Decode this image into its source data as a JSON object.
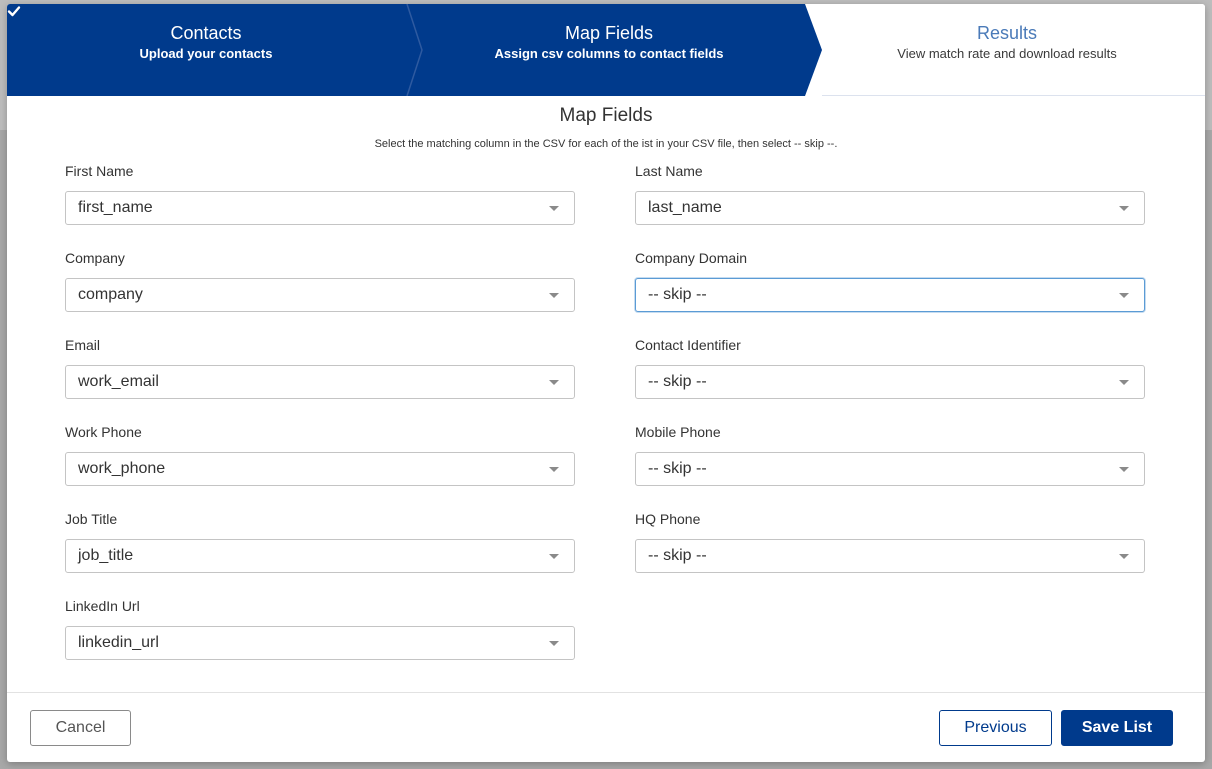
{
  "steps": [
    {
      "title": "Contacts",
      "subtitle": "Upload your contacts",
      "state": "complete"
    },
    {
      "title": "Map Fields",
      "subtitle": "Assign csv columns to contact fields",
      "state": "active"
    },
    {
      "title": "Results",
      "subtitle": "View match rate and download results",
      "state": "upcoming"
    }
  ],
  "colors": {
    "brand": "#003a8c",
    "step_inactive_title": "#4a7ab8",
    "focus_border": "#5b9bd5"
  },
  "page": {
    "title": "Map Fields",
    "subtitle": "Select the matching column in the CSV for each of the ist in your CSV file, then select -- skip --."
  },
  "fields": {
    "first_name": {
      "label": "First Name",
      "value": "first_name"
    },
    "last_name": {
      "label": "Last Name",
      "value": "last_name"
    },
    "company": {
      "label": "Company",
      "value": "company"
    },
    "company_domain": {
      "label": "Company Domain",
      "value": "-- skip --"
    },
    "email": {
      "label": "Email",
      "value": "work_email"
    },
    "contact_identifier": {
      "label": "Contact Identifier",
      "value": "-- skip --"
    },
    "work_phone": {
      "label": "Work Phone",
      "value": "work_phone"
    },
    "mobile_phone": {
      "label": "Mobile Phone",
      "value": "-- skip --"
    },
    "job_title": {
      "label": "Job Title",
      "value": "job_title"
    },
    "hq_phone": {
      "label": "HQ Phone",
      "value": "-- skip --"
    },
    "linkedin_url": {
      "label": "LinkedIn Url",
      "value": "linkedin_url"
    }
  },
  "footer": {
    "cancel_label": "Cancel",
    "previous_label": "Previous",
    "save_label": "Save List"
  }
}
